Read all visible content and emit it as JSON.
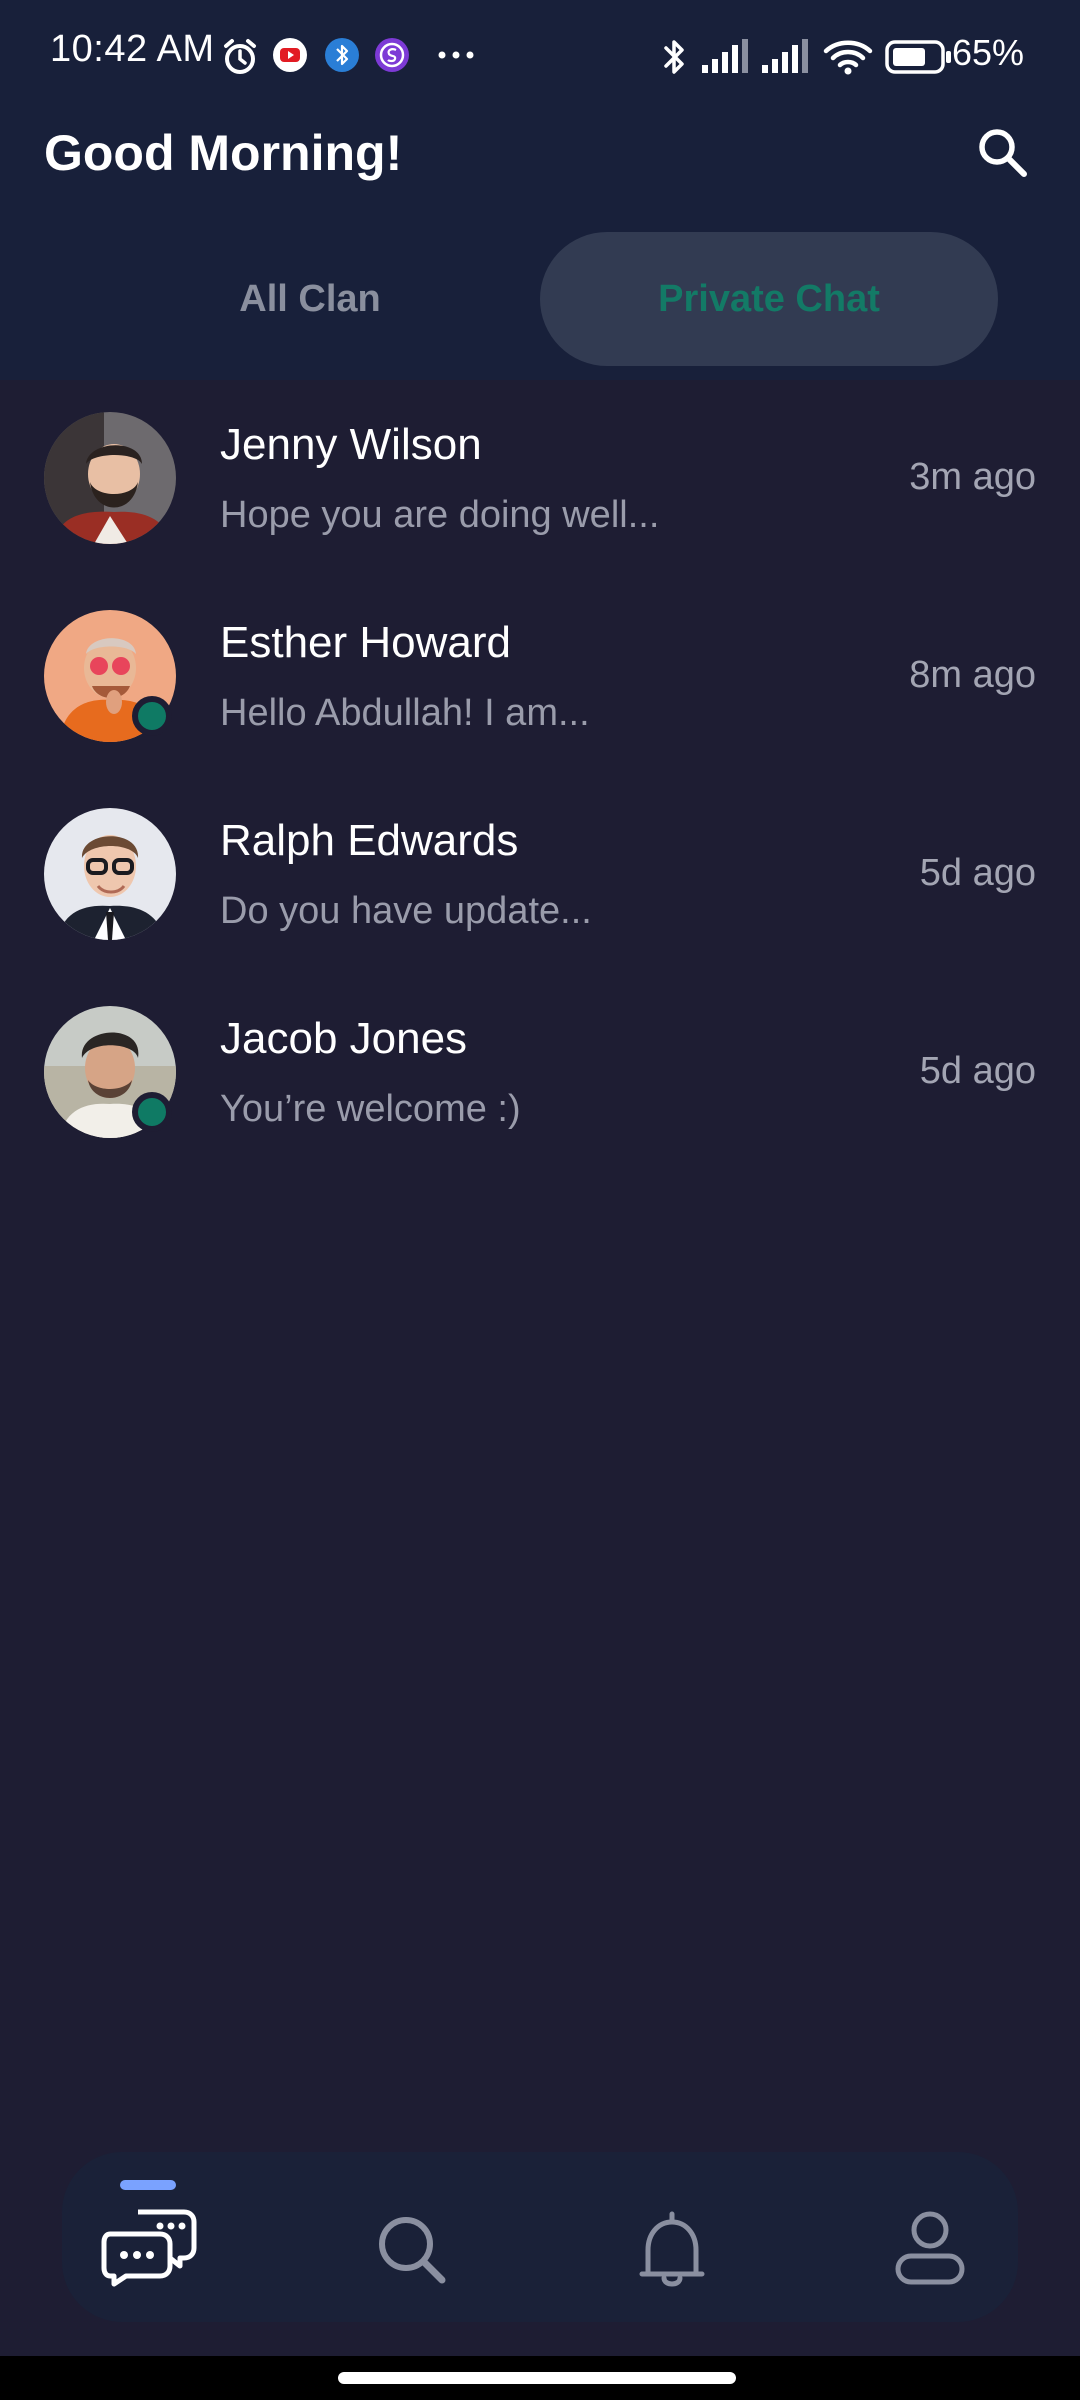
{
  "status_bar": {
    "time": "10:42 AM",
    "battery": "65%",
    "icons": [
      "alarm-icon",
      "youtube-icon",
      "bluetooth-app-icon",
      "purple-app-icon",
      "more-dots-icon",
      "bluetooth-icon",
      "signal-icon",
      "signal-icon",
      "wifi-icon",
      "battery-icon"
    ]
  },
  "header": {
    "greeting": "Good Morning!",
    "search_icon": "search-icon"
  },
  "tabs": [
    {
      "label": "All Clan",
      "active": false
    },
    {
      "label": "Private Chat",
      "active": true
    }
  ],
  "chats": [
    {
      "name": "Jenny Wilson",
      "message": "Hope you are doing well...",
      "time": "3m ago",
      "online": false
    },
    {
      "name": "Esther Howard",
      "message": "Hello Abdullah! I am...",
      "time": "8m ago",
      "online": true
    },
    {
      "name": "Ralph Edwards",
      "message": "Do you have update...",
      "time": "5d ago",
      "online": false
    },
    {
      "name": "Jacob Jones",
      "message": "You’re welcome :)",
      "time": "5d ago",
      "online": true
    }
  ],
  "bottom_nav": [
    {
      "icon": "chat-bubbles-icon",
      "active": true
    },
    {
      "icon": "search-icon",
      "active": false
    },
    {
      "icon": "bell-icon",
      "active": false
    },
    {
      "icon": "profile-icon",
      "active": false
    }
  ],
  "colors": {
    "background": "#1e1d33",
    "header_background": "#18203a",
    "accent": "#137a66",
    "online": "#0f7a64",
    "nav_indicator": "#7aa2ff"
  }
}
